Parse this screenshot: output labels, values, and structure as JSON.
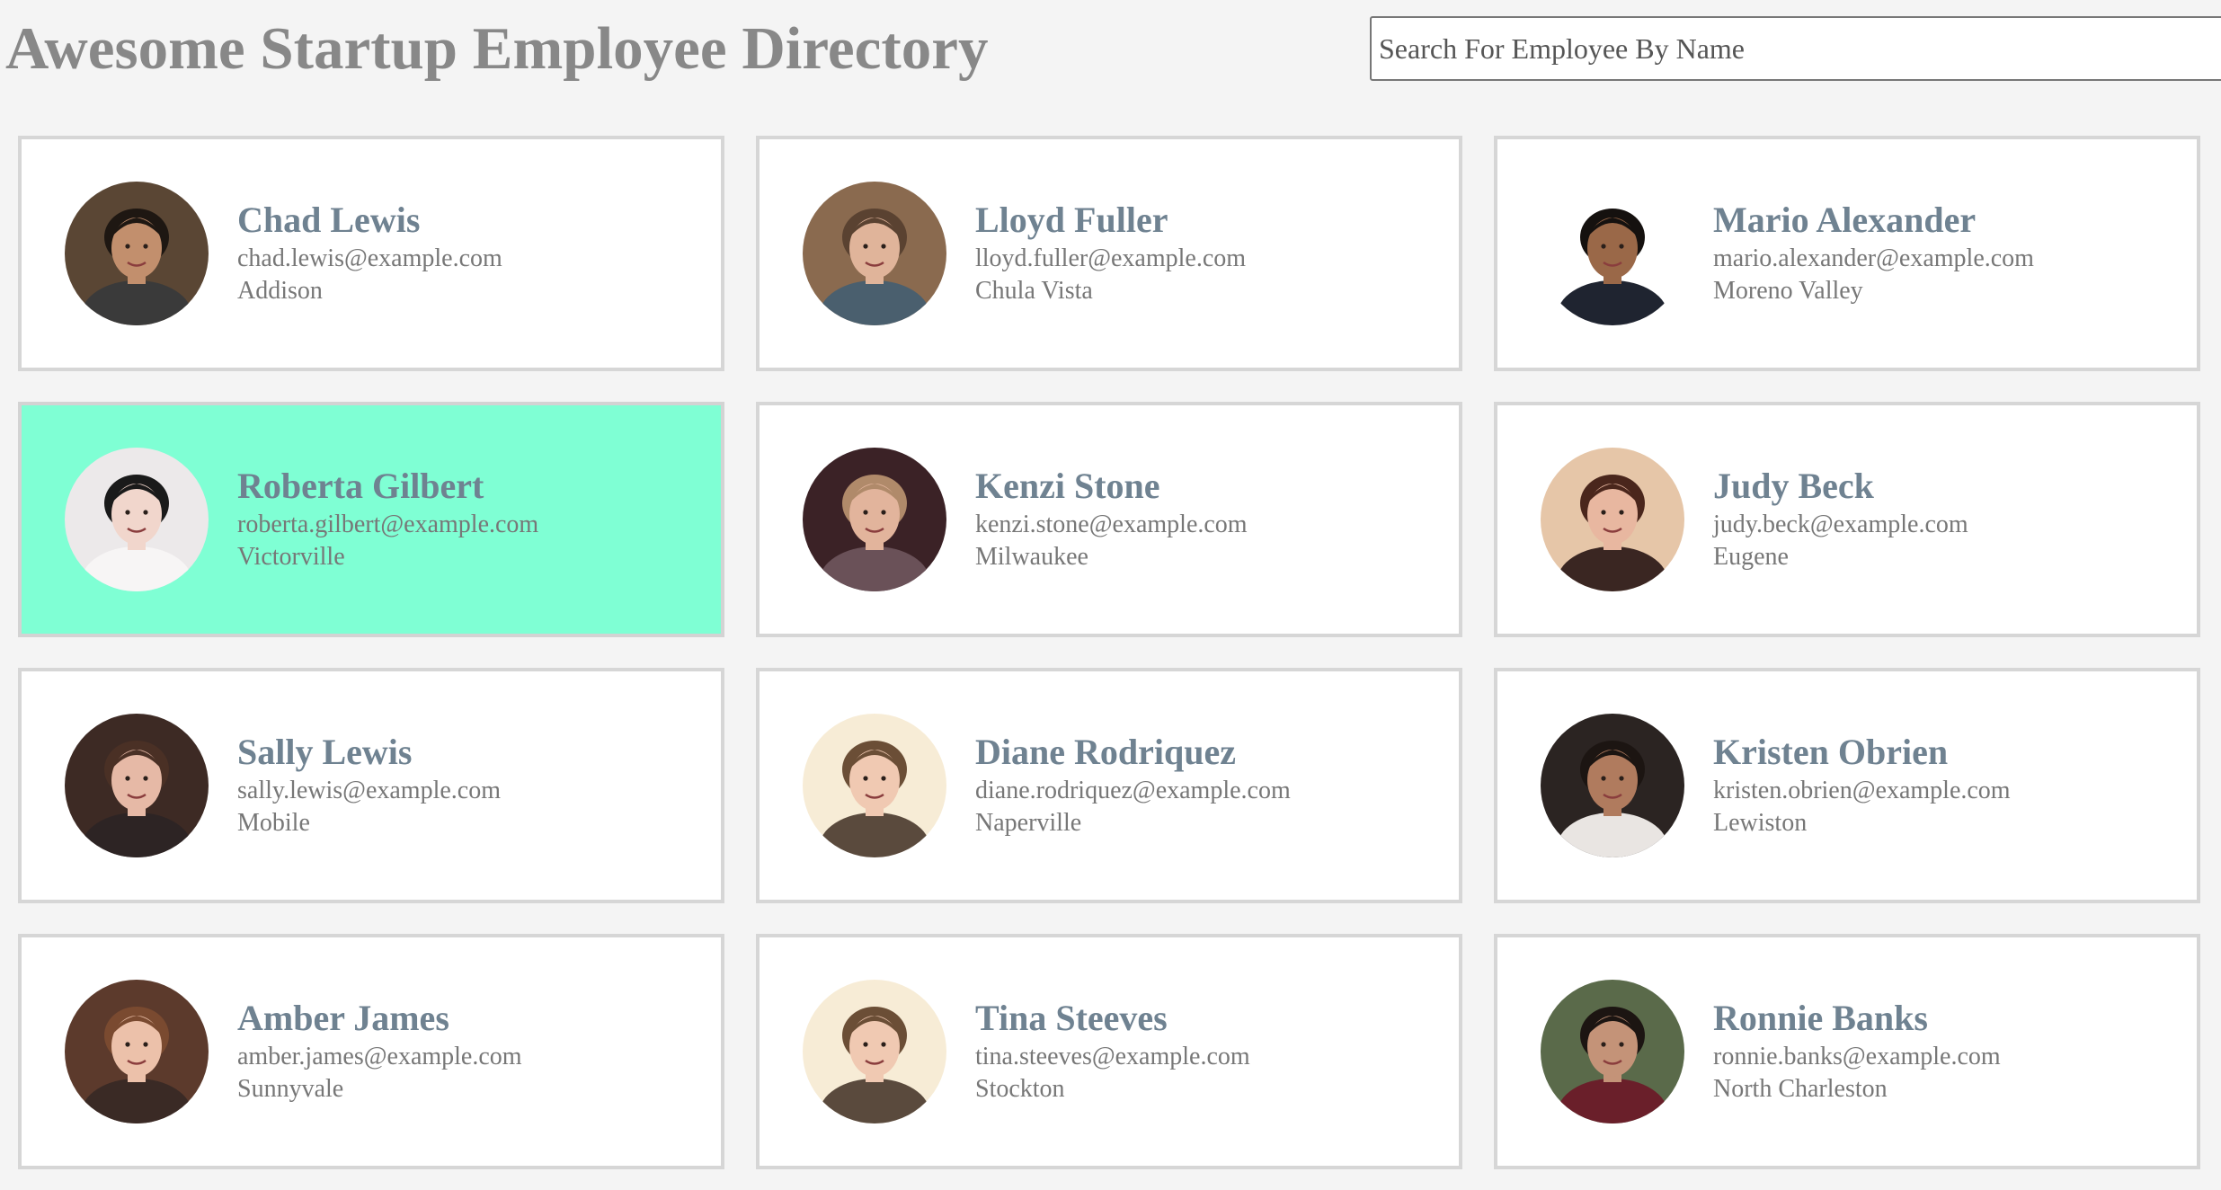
{
  "header": {
    "title": "Awesome Startup Employee Directory",
    "search_placeholder": "Search For Employee By Name",
    "search_value": ""
  },
  "colors": {
    "selected_card": "#7fffd4",
    "name_text": "#6f8291",
    "page_background": "#f4f4f4"
  },
  "employees": [
    {
      "name": "Chad Lewis",
      "email": "chad.lewis@example.com",
      "city": "Addison",
      "selected": false,
      "avatar": {
        "bg": "#5a4634",
        "skin": "#c28f6d",
        "hair": "#1e1712",
        "shirt": "#3a3a3a"
      }
    },
    {
      "name": "Lloyd Fuller",
      "email": "lloyd.fuller@example.com",
      "city": "Chula Vista",
      "selected": false,
      "avatar": {
        "bg": "#8a6a4f",
        "skin": "#e0b49a",
        "hair": "#5a4231",
        "shirt": "#4a5f6e"
      }
    },
    {
      "name": "Mario Alexander",
      "email": "mario.alexander@example.com",
      "city": "Moreno Valley",
      "selected": false,
      "avatar": {
        "bg": "#ffffff",
        "skin": "#9a6848",
        "hair": "#15110f",
        "shirt": "#1f2430"
      }
    },
    {
      "name": "Roberta Gilbert",
      "email": "roberta.gilbert@example.com",
      "city": "Victorville",
      "selected": true,
      "avatar": {
        "bg": "#ece9ea",
        "skin": "#f1d6cc",
        "hair": "#1a1a1a",
        "shirt": "#f7f5f5"
      }
    },
    {
      "name": "Kenzi Stone",
      "email": "kenzi.stone@example.com",
      "city": "Milwaukee",
      "selected": false,
      "avatar": {
        "bg": "#3b2226",
        "skin": "#e2b49c",
        "hair": "#b08a6a",
        "shirt": "#6a5158"
      }
    },
    {
      "name": "Judy Beck",
      "email": "judy.beck@example.com",
      "city": "Eugene",
      "selected": false,
      "avatar": {
        "bg": "#e6c6a8",
        "skin": "#e8b7a0",
        "hair": "#4a261c",
        "shirt": "#3a2622"
      }
    },
    {
      "name": "Sally Lewis",
      "email": "sally.lewis@example.com",
      "city": "Mobile",
      "selected": false,
      "avatar": {
        "bg": "#3d2a24",
        "skin": "#e6b9a6",
        "hair": "#4a3025",
        "shirt": "#2d2424"
      }
    },
    {
      "name": "Diane Rodriquez",
      "email": "diane.rodriquez@example.com",
      "city": "Naperville",
      "selected": false,
      "avatar": {
        "bg": "#f7ecd6",
        "skin": "#f0c9b2",
        "hair": "#6b4e36",
        "shirt": "#5a4a3d"
      }
    },
    {
      "name": "Kristen Obrien",
      "email": "kristen.obrien@example.com",
      "city": "Lewiston",
      "selected": false,
      "avatar": {
        "bg": "#2b2422",
        "skin": "#b07b5e",
        "hair": "#1c1512",
        "shirt": "#e9e5e2"
      }
    },
    {
      "name": "Amber James",
      "email": "amber.james@example.com",
      "city": "Sunnyvale",
      "selected": false,
      "avatar": {
        "bg": "#5c3a2c",
        "skin": "#ecc1aa",
        "hair": "#7a4a30",
        "shirt": "#3a2a25"
      }
    },
    {
      "name": "Tina Steeves",
      "email": "tina.steeves@example.com",
      "city": "Stockton",
      "selected": false,
      "avatar": {
        "bg": "#f7ecd6",
        "skin": "#f0c9b2",
        "hair": "#6b4e36",
        "shirt": "#5a4a3d"
      }
    },
    {
      "name": "Ronnie Banks",
      "email": "ronnie.banks@example.com",
      "city": "North Charleston",
      "selected": false,
      "avatar": {
        "bg": "#5a6a4a",
        "skin": "#c49378",
        "hair": "#1c1512",
        "shirt": "#6a1f2a"
      }
    }
  ]
}
